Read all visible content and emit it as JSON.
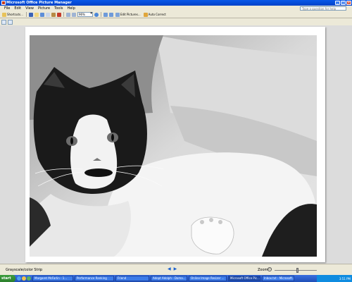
{
  "window": {
    "title": "Microsoft Office Picture Manager"
  },
  "menu": [
    "File",
    "Edit",
    "View",
    "Picture",
    "Tools",
    "Help"
  ],
  "help_box": {
    "placeholder": "Type a question for help"
  },
  "toolbar": {
    "shortcuts_label": "Shortcuts...",
    "zoom_value": "96%",
    "edit_pictures_label": "Edit Pictures...",
    "auto_correct_label": "Auto Correct"
  },
  "status": {
    "info": "Grayscale/color Strip",
    "zoom_label": "Zoom:",
    "zoom_level": 0.55
  },
  "taskbar": {
    "start_label": "start",
    "tasks": [
      "Margaret McFarlin - 1...",
      "Performance Ranking",
      "Friend",
      "Adopt Adolph - Doma...",
      "Online Image Resizer ...",
      "Microsoft Office Pic...",
      "Inbox.txt - Microsoft...",
      "Microsoft Office Pic..."
    ],
    "tray_time": "3:51 PM"
  }
}
